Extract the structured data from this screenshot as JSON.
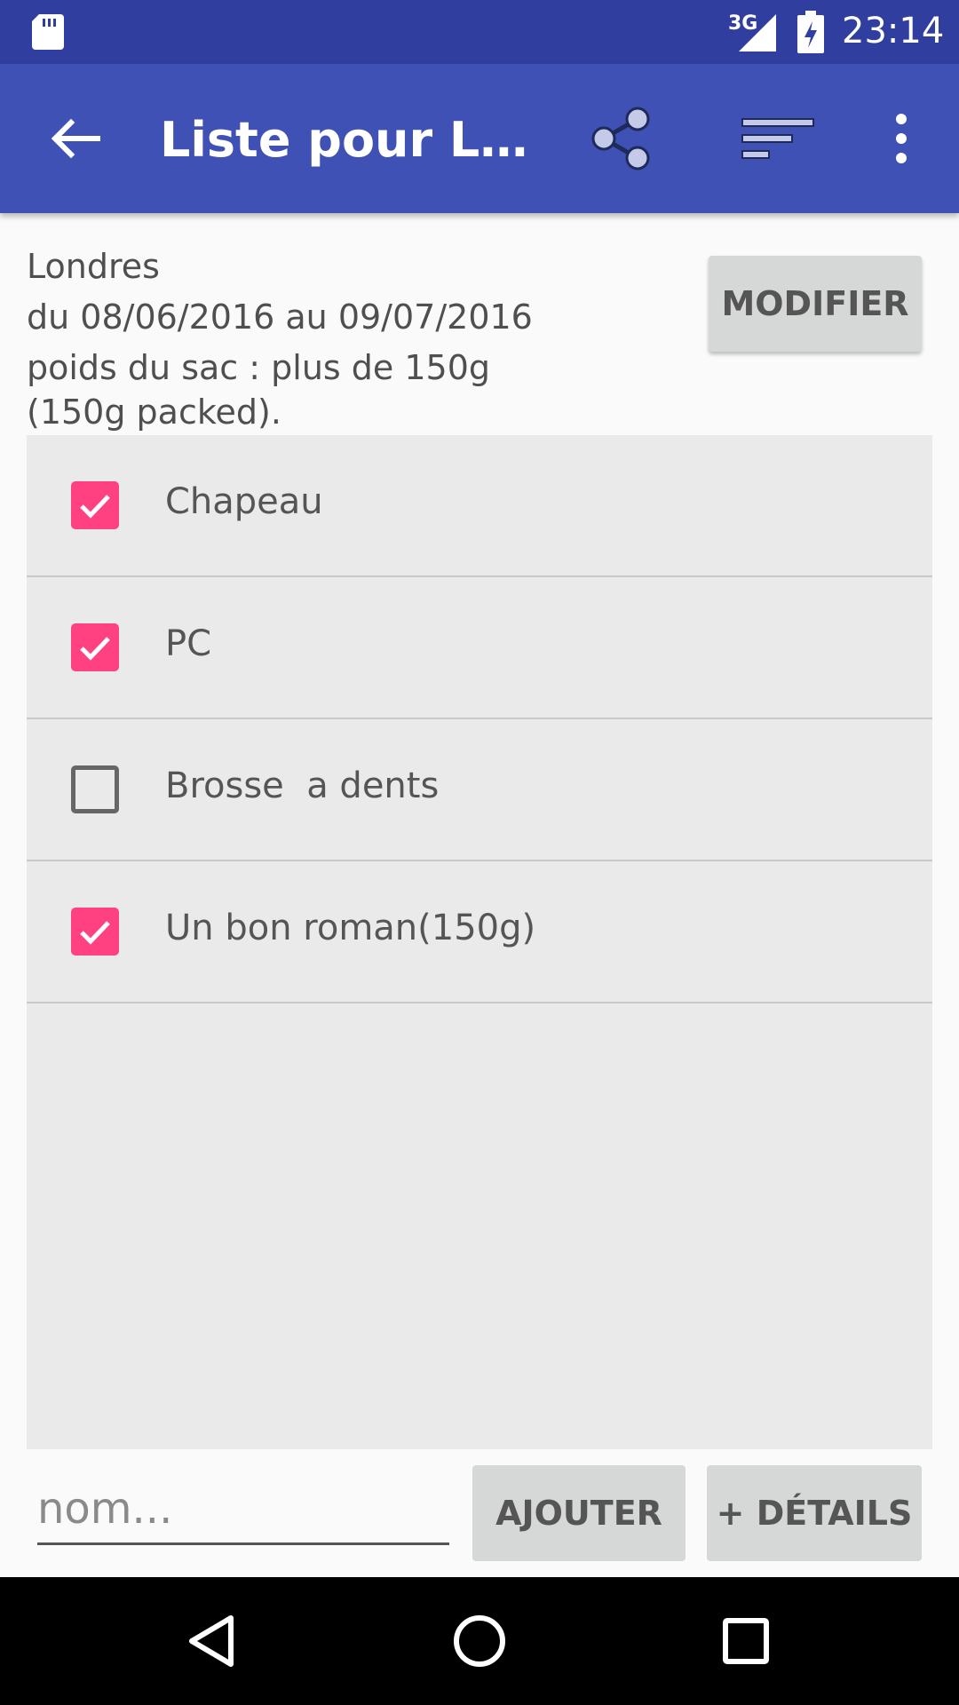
{
  "status_bar": {
    "network": "3G",
    "time": "23:14",
    "icons": [
      "sd-card-icon",
      "signal-icon",
      "battery-charging-icon"
    ]
  },
  "app_bar": {
    "title": "Liste pour Londres",
    "icons": [
      "back-arrow-icon",
      "share-icon",
      "sort-icon",
      "more-vert-icon"
    ]
  },
  "trip": {
    "destination": "Londres",
    "dates": "du 08/06/2016 au 09/07/2016",
    "weight": "poids du sac : plus de 150g",
    "packed": "(150g packed)."
  },
  "buttons": {
    "modify": "MODIFIER",
    "add": "AJOUTER",
    "details": "+ DÉTAILS"
  },
  "items": [
    {
      "label": "Chapeau",
      "checked": true
    },
    {
      "label": "PC",
      "checked": true
    },
    {
      "label": "Brosse  a dents",
      "checked": false
    },
    {
      "label": "Un bon roman(150g)",
      "checked": true
    }
  ],
  "name_input": {
    "placeholder": "nom...",
    "value": ""
  },
  "colors": {
    "status_bar": "#303f9f",
    "app_bar": "#3f51b5",
    "accent": "#ff4081"
  },
  "nav_bar": {
    "icons": [
      "back-triangle-icon",
      "home-circle-icon",
      "recents-square-icon"
    ]
  }
}
